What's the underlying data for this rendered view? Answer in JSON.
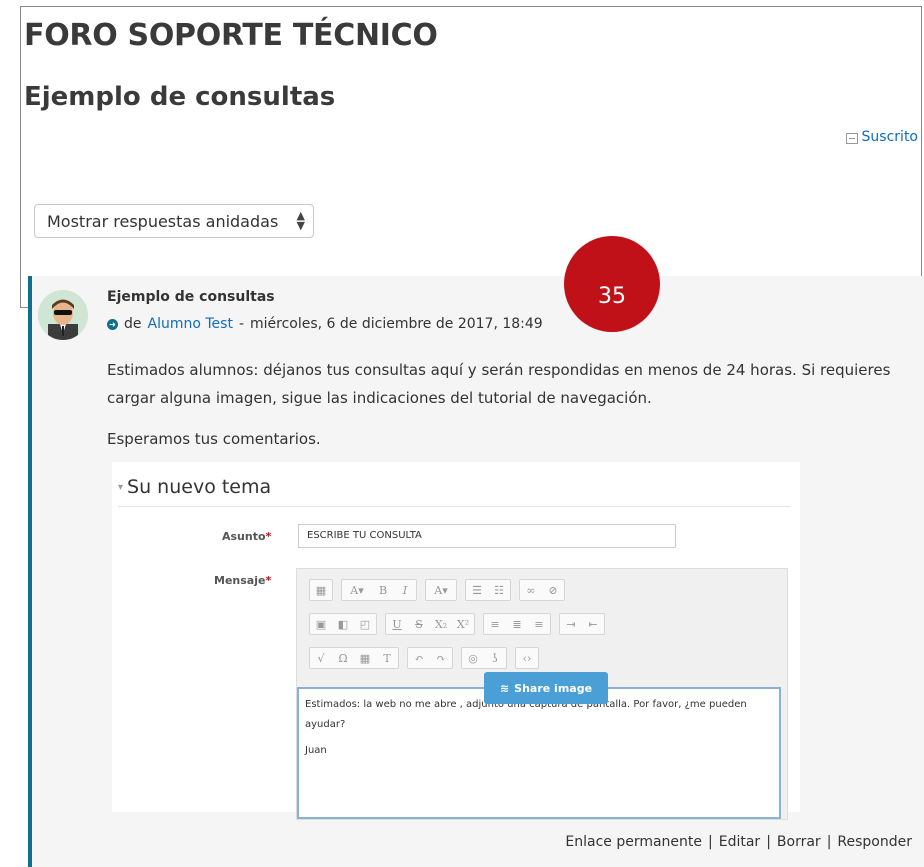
{
  "forum": {
    "title": "FORO SOPORTE TÉCNICO",
    "discussion_title": "Ejemplo de consultas",
    "subscribed_label": "Suscrito",
    "display_mode": "Mostrar respuestas anidadas"
  },
  "badge": {
    "number": "35",
    "color": "#c01018"
  },
  "post": {
    "subject": "Ejemplo de consultas",
    "by_prefix": "de",
    "author": "Alumno Test",
    "date_sep": "-",
    "date": "miércoles, 6 de diciembre de 2017, 18:49",
    "body_p1": "Estimados alumnos: déjanos tus consultas aquí y serán respondidas en menos de 24 horas. Si requieres cargar alguna imagen, sigue las indicaciones del tutorial de navegación.",
    "body_p2": "Esperamos tus comentarios.",
    "accent_color": "#0f6f8e"
  },
  "embedded_form": {
    "legend": "Su nuevo tema",
    "subject_label": "Asunto",
    "subject_value": "ESCRIBE TU CONSULTA",
    "message_label": "Mensaje",
    "required_mark": "*",
    "message_line1": "Estimados: la web no me abre , adjunto una captura de pantalla. Por favor, ¿me pueden ayudar?",
    "message_line2": "Juan",
    "share_button": "Share image"
  },
  "actions": {
    "permalink": "Enlace permanente",
    "edit": "Editar",
    "delete": "Borrar",
    "reply": "Responder",
    "separator": "|"
  }
}
